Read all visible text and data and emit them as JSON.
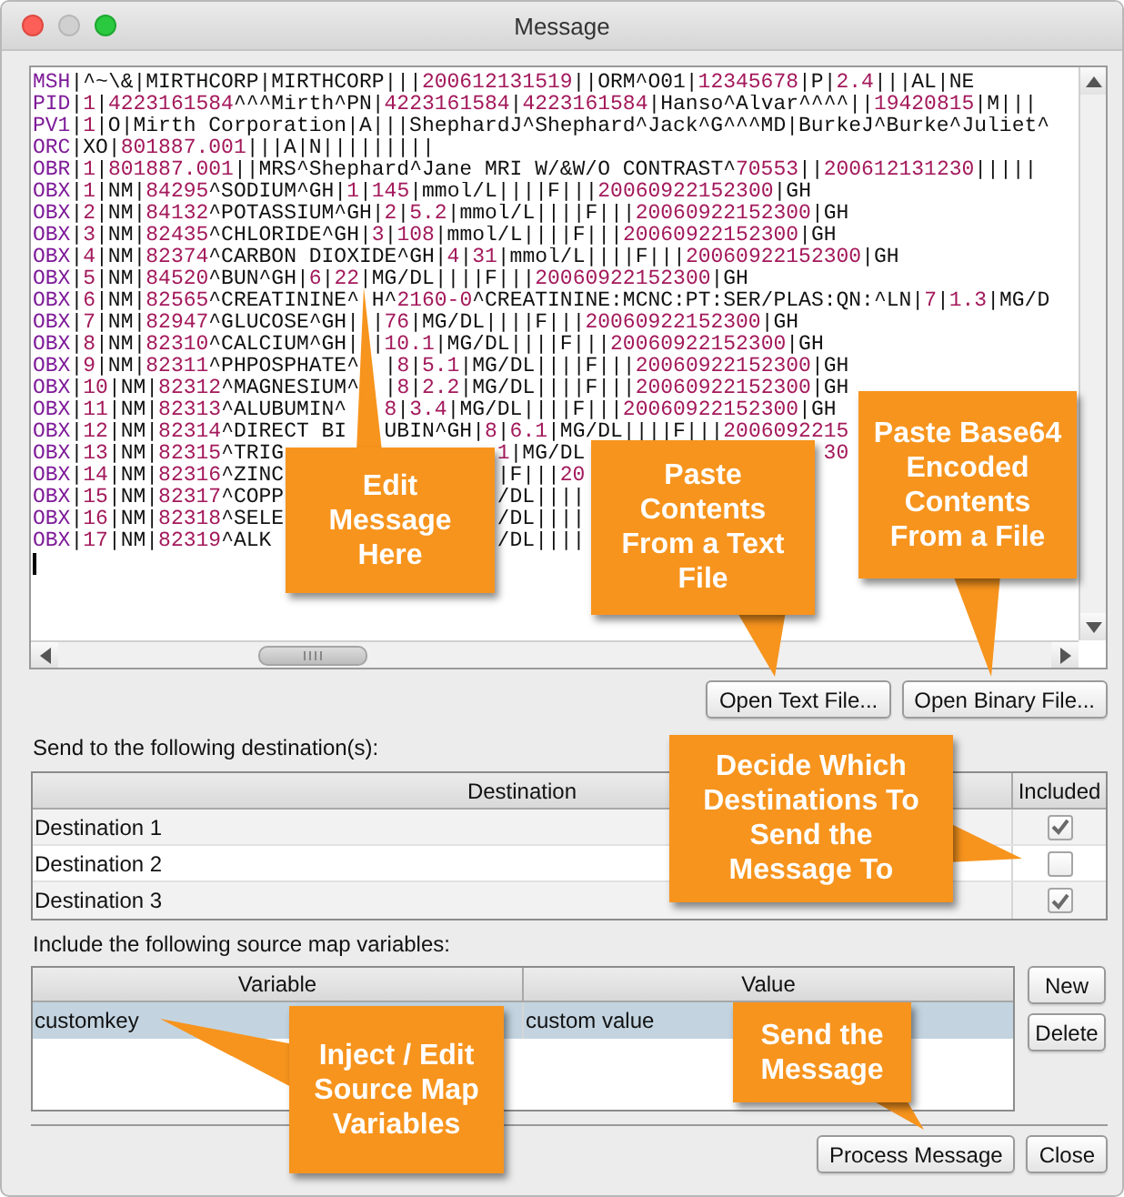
{
  "window": {
    "title": "Message"
  },
  "message_lines": [
    {
      "runs": [
        "MSH|^~\\&|MIRTHCORP|MIRTHCORP|||200612131519||ORM^O01|12345678|P|2.4|||AL|NE"
      ]
    },
    {
      "runs": [
        "PID|1|4223161584^^^Mirth^PN|4223161584|4223161584|Hanso^Alvar^^^^||19420815|M|||"
      ]
    },
    {
      "runs": [
        "PV1|1|O|Mirth Corporation|A|||ShephardJ^Shephard^Jack^G^^^MD|BurkeJ^Burke^Juliet^"
      ]
    },
    {
      "runs": [
        "ORC|XO|801887.001|||A|N|||||||||"
      ]
    },
    {
      "runs": [
        "OBR|1|801887.001||MRS^Shephard^Jane MRI W/&W/O CONTRAST^70553||200612131230|||||"
      ]
    },
    {
      "runs": [
        "OBX|1|NM|84295^SODIUM^GH|1|145|mmol/L||||F|||20060922152300|GH"
      ]
    },
    {
      "runs": [
        "OBX|2|NM|84132^POTASSIUM^GH|2|5.2|mmol/L||||F|||20060922152300|GH"
      ]
    },
    {
      "runs": [
        "OBX|3|NM|82435^CHLORIDE^GH|3|108|mmol/L||||F|||20060922152300|GH"
      ]
    },
    {
      "runs": [
        "OBX|4|NM|82374^CARBON DIOXIDE^GH|4|31|mmol/L||||F|||20060922152300|GH"
      ]
    },
    {
      "runs": [
        "OBX|5|NM|84520^BUN^GH|6|22|MG/DL||||F|||20060922152300|GH"
      ]
    },
    {
      "runs": [
        "OBX|6|NM|82565^CREATININE^",
        "H^2160-0^CREATININE:MCNC:PT:SER/PLAS:QN:^LN|7|1.3|MG/D"
      ]
    },
    {
      "runs": [
        "OBX|7|NM|82947^GLUCOSE^GH|",
        "|76|MG/DL||||F|||20060922152300|GH"
      ]
    },
    {
      "runs": [
        "OBX|8|NM|82310^CALCIUM^GH|",
        "|10.1|MG/DL||||F|||20060922152300|GH"
      ]
    },
    {
      "runs": [
        "OBX|9|NM|82311^PHPOSPHATE^",
        "|8|5.1|MG/DL||||F|||20060922152300|GH"
      ]
    },
    {
      "runs": [
        "OBX|10|NM|82312^MAGNESIUM^",
        "|8|2.2|MG/DL||||F|||20060922152300|GH"
      ]
    },
    {
      "runs": [
        "OBX|11|NM|82313^ALUBUMIN^",
        "8|3.4|MG/DL||||F|||20060922152300|GH"
      ]
    },
    {
      "runs": [
        "OBX|12|NM|82314^DIRECT BI",
        "UBIN^GH|8|6.1|MG/DL||||F|||2006092215"
      ]
    },
    {
      "runs": [
        "OBX|13|NM|82315^TRIG",
        "1|MG/DL",
        "30"
      ]
    },
    {
      "runs": [
        "OBX|14|NM|82316^ZINC",
        "|F|||20"
      ]
    },
    {
      "runs": [
        "OBX|15|NM|82317^COPP",
        "/DL||||"
      ]
    },
    {
      "runs": [
        "OBX|16|NM|82318^SELE",
        "/DL||||"
      ]
    },
    {
      "runs": [
        "OBX|17|NM|82319^ALK",
        "/DL||||"
      ]
    }
  ],
  "message_buttons": [
    "Open Text File...",
    "Open Binary File..."
  ],
  "destinations": {
    "label": "Send to the following destination(s):",
    "columns": [
      "Destination",
      "Included"
    ],
    "rows": [
      {
        "name": "Destination 1",
        "included": true
      },
      {
        "name": "Destination 2",
        "included": false
      },
      {
        "name": "Destination 3",
        "included": true
      }
    ]
  },
  "variables": {
    "label": "Include the following source map variables:",
    "columns": [
      "Variable",
      "Value"
    ],
    "rows": [
      {
        "variable": "customkey",
        "value": "custom value",
        "selected": true
      }
    ],
    "buttons": [
      "New",
      "Delete"
    ]
  },
  "footer_buttons": [
    "Process Message",
    "Close"
  ],
  "annotations": [
    {
      "text": "Edit\nMessage\nHere"
    },
    {
      "text": "Paste\nContents\nFrom a Text\nFile"
    },
    {
      "text": "Paste Base64\nEncoded\nContents\nFrom a File"
    },
    {
      "text": "Decide Which\nDestinations To\nSend the\nMessage To"
    },
    {
      "text": "Inject / Edit\nSource Map\nVariables"
    },
    {
      "text": "Send the\nMessage"
    }
  ]
}
